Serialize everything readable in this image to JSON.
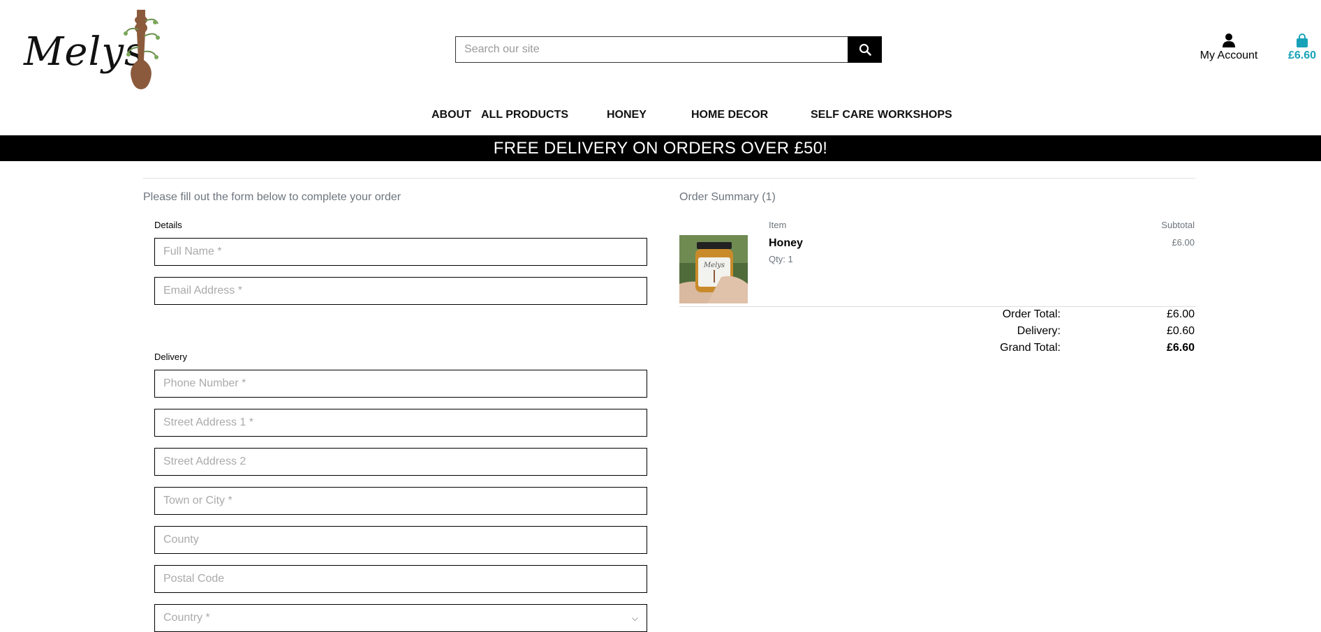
{
  "brand": {
    "logo_text": "Melys"
  },
  "search": {
    "placeholder": "Search our site"
  },
  "account": {
    "label": "My Account"
  },
  "bag": {
    "total": "£6.60"
  },
  "nav": {
    "about": "ABOUT",
    "all_products": "ALL PRODUCTS",
    "honey": "HONEY",
    "home_decor": "HOME DECOR",
    "self_care": "SELF CARE",
    "workshops": "WORKSHOPS"
  },
  "banner": {
    "text": "FREE DELIVERY ON ORDERS OVER £50!"
  },
  "form": {
    "intro": "Please fill out the form below to complete your order",
    "details_legend": "Details",
    "delivery_legend": "Delivery",
    "full_name_placeholder": "Full Name *",
    "email_placeholder": "Email Address *",
    "phone_placeholder": "Phone Number *",
    "street1_placeholder": "Street Address 1 *",
    "street2_placeholder": "Street Address 2",
    "town_placeholder": "Town or City *",
    "county_placeholder": "County",
    "postcode_placeholder": "Postal Code",
    "country_placeholder": "Country *"
  },
  "summary": {
    "title": "Order Summary (1)",
    "col_item": "Item",
    "col_subtotal": "Subtotal",
    "items": [
      {
        "name": "Honey",
        "qty": "Qty: 1",
        "subtotal": "£6.00"
      }
    ],
    "order_total_label": "Order Total:",
    "order_total_value": "£6.00",
    "delivery_label": "Delivery:",
    "delivery_value": "£0.60",
    "grand_total_label": "Grand Total:",
    "grand_total_value": "£6.60"
  },
  "colors": {
    "accent": "#17a2b8",
    "banner_bg": "#000000",
    "muted_text": "#6c757d"
  }
}
